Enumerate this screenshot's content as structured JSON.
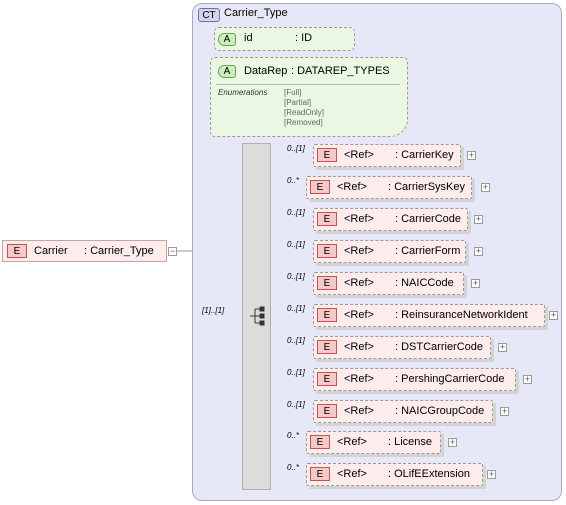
{
  "root": {
    "badge": "E",
    "name": "Carrier",
    "type": ": Carrier_Type",
    "toggle": "−"
  },
  "complex_type": {
    "badge": "CT",
    "name": "Carrier_Type"
  },
  "attributes": [
    {
      "badge": "A",
      "name": "id",
      "type": ": ID"
    },
    {
      "badge": "A",
      "name": "DataRep",
      "type": ": DATAREP_TYPES",
      "enum_label": "Enumerations",
      "enum_values": [
        "[Full]",
        "[Partial]",
        "[ReadOnly]",
        "[Removed]"
      ]
    }
  ],
  "sequence": {
    "occurrence": "[1]..[1]"
  },
  "elements": [
    {
      "occ": "0..[1]",
      "ref": "<Ref>",
      "name": ": CarrierKey",
      "toggle": "+"
    },
    {
      "occ": "0..*",
      "ref": "<Ref>",
      "name": ": CarrierSysKey",
      "toggle": "+"
    },
    {
      "occ": "0..[1]",
      "ref": "<Ref>",
      "name": ": CarrierCode",
      "toggle": "+"
    },
    {
      "occ": "0..[1]",
      "ref": "<Ref>",
      "name": ": CarrierForm",
      "toggle": "+"
    },
    {
      "occ": "0..[1]",
      "ref": "<Ref>",
      "name": ": NAICCode",
      "toggle": "+"
    },
    {
      "occ": "0..[1]",
      "ref": "<Ref>",
      "name": ": ReinsuranceNetworkIdent",
      "toggle": "+"
    },
    {
      "occ": "0..[1]",
      "ref": "<Ref>",
      "name": ": DSTCarrierCode",
      "toggle": "+"
    },
    {
      "occ": "0..[1]",
      "ref": "<Ref>",
      "name": ": PershingCarrierCode",
      "toggle": "+"
    },
    {
      "occ": "0..[1]",
      "ref": "<Ref>",
      "name": ": NAICGroupCode",
      "toggle": "+"
    },
    {
      "occ": "0..*",
      "ref": "<Ref>",
      "name": ": License",
      "toggle": "+"
    },
    {
      "occ": "0..*",
      "ref": "<Ref>",
      "name": ": OLifEExtension",
      "toggle": "+"
    }
  ],
  "colors": {
    "ct_bg": "#e6e7f7",
    "attr_bg": "#eaf8e3",
    "element_bg": "#fdecec",
    "element_badge": "#f6c9c9"
  }
}
